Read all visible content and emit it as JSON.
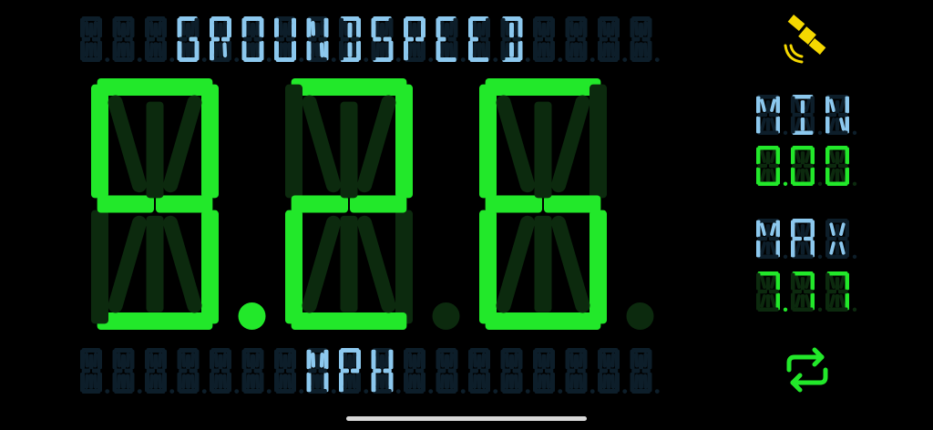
{
  "title": "GROUNDSPEED",
  "speed": {
    "value": "9.26",
    "integer": "9",
    "decimals": "26"
  },
  "unit": "MPH",
  "stats": {
    "min_label": "MIN",
    "min_value": "0.00",
    "max_label": "MAX",
    "max_value": "7.77"
  },
  "icons": {
    "gps": "satellite-icon",
    "reset": "refresh-icon"
  },
  "colors": {
    "digit_on": "#22e82a",
    "label_on": "#8cc8ee",
    "satellite": "#f5d800",
    "digit_off": "#0c2a0e",
    "label_off": "#0d1e2a"
  }
}
